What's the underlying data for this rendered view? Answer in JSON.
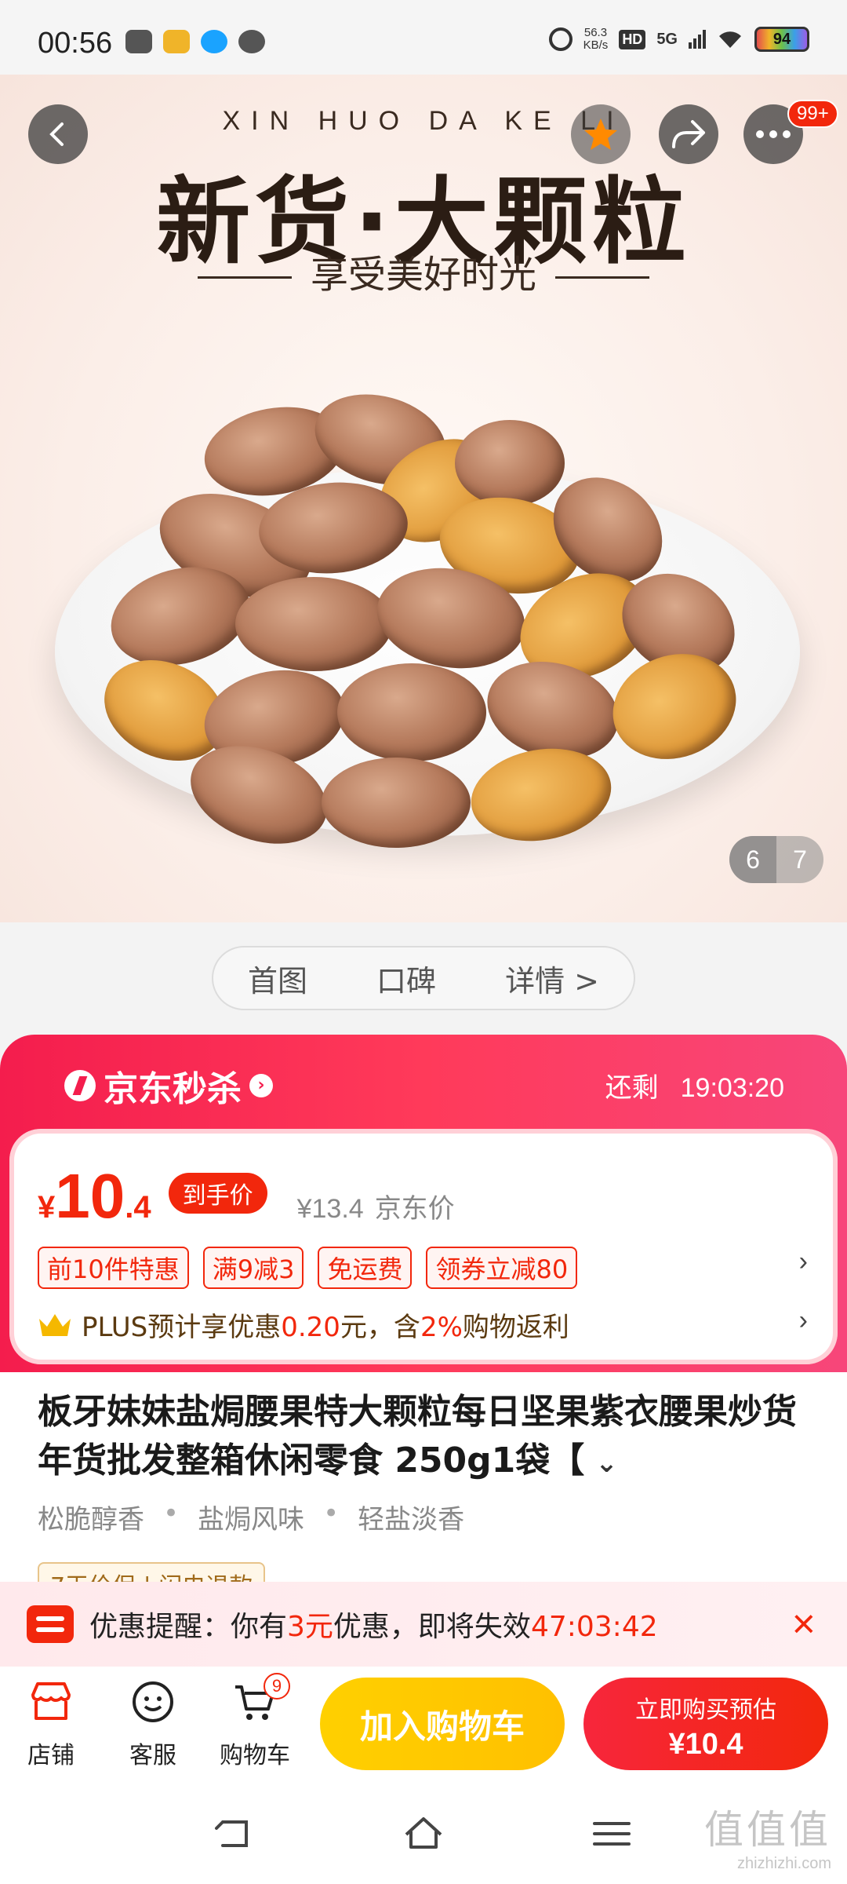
{
  "status_bar": {
    "time": "00:56",
    "net_speed_value": "56.3",
    "net_speed_unit": "KB/s",
    "hd": "HD",
    "network": "5G",
    "battery": "94"
  },
  "hero": {
    "pinyin": "XIN HUO   DA KE LI",
    "title": "新货·大颗粒",
    "subtitle": "享受美好时光",
    "image_index": "6",
    "image_total": "7"
  },
  "top_actions": {
    "badge": "99+"
  },
  "segment_tabs": [
    "首图",
    "口碑",
    "详情 >"
  ],
  "flash_sale": {
    "title": "京东秒杀",
    "remain_label": "还剩",
    "countdown": "19:03:20",
    "price_symbol": "¥",
    "price_int": "10",
    "price_dec": ".4",
    "price_tag": "到手价",
    "old_price": "¥13.4",
    "old_price_label": "京东价",
    "coupons": [
      "前10件特惠",
      "满9减3",
      "免运费",
      "领券立减80"
    ],
    "plus_text_1": "PLUS预计享优惠",
    "plus_amount": "0.20",
    "plus_text_2": "元，含",
    "plus_rate": "2%",
    "plus_text_3": "购物返利",
    "chevron": "›"
  },
  "product": {
    "title": "板牙妹妹盐焗腰果特大颗粒每日坚果紫衣腰果炒货年货批发整箱休闲零食 250g1袋【",
    "features": [
      "松脆醇香",
      "盐焗风味",
      "轻盐淡香"
    ],
    "guarantee": "7天价保 | 闪电退款"
  },
  "reminder": {
    "prefix": "优惠提醒：你有",
    "amount": "3元",
    "middle": "优惠，即将失效",
    "countdown": "47:03:42",
    "close": "×"
  },
  "action_bar": {
    "store": "店铺",
    "service": "客服",
    "cart": "购物车",
    "cart_count": "9",
    "add_to_cart": "加入购物车",
    "buy_line1": "立即购买预估",
    "buy_line2": "¥10.4"
  },
  "watermark": {
    "line1": "值值值",
    "line2": "zhizhizhi.com"
  },
  "colors": {
    "accent": "#f2270c",
    "flash_bg": "#f41d4d",
    "cart_button": "#ffc000"
  }
}
